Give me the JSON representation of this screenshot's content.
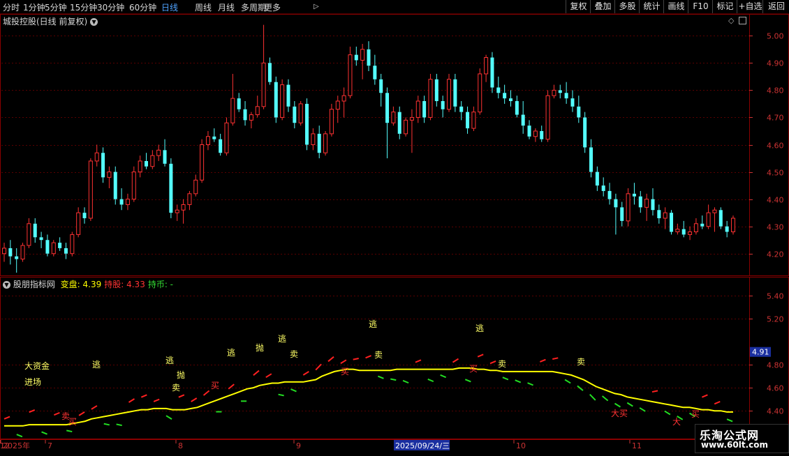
{
  "toolbar": {
    "periods": [
      "分时",
      "1分钟",
      "5分钟",
      "15分钟",
      "30分钟",
      "60分钟",
      "日线",
      "周线",
      "月线",
      "多周期",
      "更多"
    ],
    "active_period": "日线",
    "more_arrow": "▷",
    "right_buttons": [
      "复权",
      "叠加",
      "多股",
      "统计",
      "画线",
      "F10",
      "标记",
      "+自选",
      "返回"
    ]
  },
  "main_panel": {
    "title": "城投控股(日线 前复权)",
    "title_icon": "chevron-down-circle-icon",
    "top_right_icons": [
      "diamond-icon",
      "expand-icon"
    ],
    "y_ticks": [
      "5.00",
      "4.90",
      "4.80",
      "4.70",
      "4.60",
      "4.50",
      "4.40",
      "4.30",
      "4.20"
    ]
  },
  "indicator_panel": {
    "name": "股朋指标网",
    "labels": [
      {
        "text": "变盘: 4.39",
        "color": "#ffff00"
      },
      {
        "text": "持股: 4.33",
        "color": "#ff3333"
      },
      {
        "text": "持币: -",
        "color": "#33dd33"
      }
    ],
    "y_ticks": [
      "5.40",
      "5.20",
      "4.80",
      "4.60",
      "4.40"
    ],
    "current_value": "4.91",
    "annotations": [
      {
        "text": "大资金",
        "color": "#ffff66"
      },
      {
        "text": "进场",
        "color": "#ffff66"
      },
      {
        "text": "逃",
        "color": "#ffff66"
      },
      {
        "text": "逃",
        "color": "#ffff66"
      },
      {
        "text": "抛",
        "color": "#ffff66"
      },
      {
        "text": "卖",
        "color": "#ffff66"
      },
      {
        "text": "逃",
        "color": "#ffff66"
      },
      {
        "text": "抛",
        "color": "#ffff66"
      },
      {
        "text": "逃",
        "color": "#ffff66"
      },
      {
        "text": "卖",
        "color": "#ffff66"
      },
      {
        "text": "逃",
        "color": "#ffff66"
      },
      {
        "text": "卖",
        "color": "#ffff66"
      },
      {
        "text": "逃",
        "color": "#ffff66"
      },
      {
        "text": "卖",
        "color": "#ffff66"
      },
      {
        "text": "卖",
        "color": "#ffff66"
      },
      {
        "text": "卖",
        "color": "#ff3333"
      },
      {
        "text": "买",
        "color": "#ff3333"
      },
      {
        "text": "买",
        "color": "#ff3333"
      },
      {
        "text": "买",
        "color": "#ff3333"
      },
      {
        "text": "买",
        "color": "#ff3333"
      },
      {
        "text": "大买",
        "color": "#ff3333"
      },
      {
        "text": "大",
        "color": "#ff3333"
      },
      {
        "text": "买",
        "color": "#ff3333"
      }
    ]
  },
  "x_axis": {
    "labels": [
      "2025年",
      "7",
      "8",
      "9",
      "2025/09/24/三",
      "10",
      "11",
      "12"
    ]
  },
  "watermark": {
    "title": "乐淘公式网",
    "url": "www.60lt.com"
  },
  "colors": {
    "up": "#ff3232",
    "down": "#54ffff",
    "ma_line": "#ffff00",
    "grid": "#5a0000",
    "axis_text": "#cc3333",
    "border": "#8a0000"
  },
  "chart_data": {
    "type": "candlestick",
    "title": "城投控股(日线 前复权)",
    "ylim": [
      4.12,
      5.08
    ],
    "candles": [
      [
        4.2,
        4.24,
        4.17,
        4.22
      ],
      [
        4.22,
        4.25,
        4.16,
        4.19
      ],
      [
        4.19,
        4.22,
        4.13,
        4.18
      ],
      [
        4.18,
        4.24,
        4.17,
        4.23
      ],
      [
        4.23,
        4.33,
        4.22,
        4.31
      ],
      [
        4.31,
        4.33,
        4.24,
        4.26
      ],
      [
        4.26,
        4.28,
        4.22,
        4.25
      ],
      [
        4.25,
        4.27,
        4.19,
        4.2
      ],
      [
        4.2,
        4.25,
        4.19,
        4.24
      ],
      [
        4.24,
        4.26,
        4.21,
        4.22
      ],
      [
        4.22,
        4.24,
        4.18,
        4.2
      ],
      [
        4.2,
        4.28,
        4.19,
        4.27
      ],
      [
        4.27,
        4.37,
        4.26,
        4.35
      ],
      [
        4.35,
        4.37,
        4.31,
        4.33
      ],
      [
        4.33,
        4.55,
        4.32,
        4.54
      ],
      [
        4.54,
        4.6,
        4.52,
        4.57
      ],
      [
        4.57,
        4.59,
        4.46,
        4.48
      ],
      [
        4.48,
        4.52,
        4.44,
        4.5
      ],
      [
        4.5,
        4.52,
        4.38,
        4.4
      ],
      [
        4.4,
        4.44,
        4.36,
        4.38
      ],
      [
        4.38,
        4.42,
        4.36,
        4.4
      ],
      [
        4.4,
        4.52,
        4.39,
        4.5
      ],
      [
        4.5,
        4.56,
        4.48,
        4.54
      ],
      [
        4.54,
        4.57,
        4.51,
        4.52
      ],
      [
        4.52,
        4.58,
        4.51,
        4.56
      ],
      [
        4.56,
        4.6,
        4.54,
        4.58
      ],
      [
        4.58,
        4.62,
        4.52,
        4.53
      ],
      [
        4.53,
        4.55,
        4.33,
        4.35
      ],
      [
        4.35,
        4.38,
        4.32,
        4.36
      ],
      [
        4.36,
        4.4,
        4.31,
        4.38
      ],
      [
        4.38,
        4.43,
        4.36,
        4.42
      ],
      [
        4.42,
        4.49,
        4.41,
        4.47
      ],
      [
        4.47,
        4.62,
        4.46,
        4.6
      ],
      [
        4.6,
        4.65,
        4.58,
        4.63
      ],
      [
        4.63,
        4.66,
        4.61,
        4.62
      ],
      [
        4.62,
        4.64,
        4.56,
        4.57
      ],
      [
        4.57,
        4.7,
        4.56,
        4.68
      ],
      [
        4.68,
        4.86,
        4.67,
        4.77
      ],
      [
        4.77,
        4.79,
        4.72,
        4.73
      ],
      [
        4.73,
        4.76,
        4.67,
        4.69
      ],
      [
        4.69,
        4.72,
        4.66,
        4.71
      ],
      [
        4.71,
        4.78,
        4.7,
        4.74
      ],
      [
        4.74,
        5.04,
        4.73,
        4.9
      ],
      [
        4.9,
        4.92,
        4.82,
        4.83
      ],
      [
        4.83,
        4.85,
        4.68,
        4.7
      ],
      [
        4.7,
        4.84,
        4.69,
        4.82
      ],
      [
        4.82,
        4.84,
        4.72,
        4.74
      ],
      [
        4.74,
        4.76,
        4.66,
        4.68
      ],
      [
        4.68,
        4.76,
        4.67,
        4.75
      ],
      [
        4.75,
        4.77,
        4.58,
        4.6
      ],
      [
        4.6,
        4.66,
        4.58,
        4.64
      ],
      [
        4.64,
        4.67,
        4.55,
        4.57
      ],
      [
        4.57,
        4.65,
        4.56,
        4.64
      ],
      [
        4.64,
        4.75,
        4.63,
        4.73
      ],
      [
        4.73,
        4.78,
        4.68,
        4.76
      ],
      [
        4.76,
        4.81,
        4.7,
        4.78
      ],
      [
        4.78,
        4.96,
        4.77,
        4.93
      ],
      [
        4.93,
        4.96,
        4.89,
        4.91
      ],
      [
        4.91,
        4.97,
        4.84,
        4.95
      ],
      [
        4.95,
        4.98,
        4.87,
        4.89
      ],
      [
        4.89,
        4.93,
        4.82,
        4.84
      ],
      [
        4.84,
        4.86,
        4.74,
        4.79
      ],
      [
        4.79,
        4.81,
        4.55,
        4.68
      ],
      [
        4.68,
        4.74,
        4.67,
        4.72
      ],
      [
        4.72,
        4.74,
        4.62,
        4.64
      ],
      [
        4.64,
        4.7,
        4.63,
        4.69
      ],
      [
        4.69,
        4.73,
        4.57,
        4.7
      ],
      [
        4.7,
        4.78,
        4.68,
        4.76
      ],
      [
        4.76,
        4.78,
        4.68,
        4.7
      ],
      [
        4.7,
        4.86,
        4.69,
        4.84
      ],
      [
        4.84,
        4.86,
        4.74,
        4.76
      ],
      [
        4.76,
        4.78,
        4.7,
        4.73
      ],
      [
        4.73,
        4.86,
        4.72,
        4.84
      ],
      [
        4.84,
        4.86,
        4.72,
        4.74
      ],
      [
        4.74,
        4.76,
        4.69,
        4.72
      ],
      [
        4.72,
        4.74,
        4.64,
        4.66
      ],
      [
        4.66,
        4.74,
        4.65,
        4.72
      ],
      [
        4.72,
        4.88,
        4.71,
        4.86
      ],
      [
        4.86,
        4.93,
        4.83,
        4.92
      ],
      [
        4.92,
        4.94,
        4.79,
        4.81
      ],
      [
        4.81,
        4.85,
        4.77,
        4.79
      ],
      [
        4.79,
        4.82,
        4.75,
        4.77
      ],
      [
        4.77,
        4.8,
        4.74,
        4.76
      ],
      [
        4.76,
        4.78,
        4.7,
        4.71
      ],
      [
        4.71,
        4.76,
        4.64,
        4.67
      ],
      [
        4.67,
        4.69,
        4.62,
        4.63
      ],
      [
        4.63,
        4.66,
        4.61,
        4.65
      ],
      [
        4.65,
        4.67,
        4.61,
        4.62
      ],
      [
        4.62,
        4.8,
        4.61,
        4.78
      ],
      [
        4.78,
        4.82,
        4.77,
        4.8
      ],
      [
        4.8,
        4.82,
        4.77,
        4.79
      ],
      [
        4.79,
        4.83,
        4.75,
        4.77
      ],
      [
        4.77,
        4.8,
        4.72,
        4.74
      ],
      [
        4.74,
        4.78,
        4.68,
        4.7
      ],
      [
        4.7,
        4.72,
        4.57,
        4.59
      ],
      [
        4.59,
        4.62,
        4.48,
        4.5
      ],
      [
        4.5,
        4.52,
        4.43,
        4.45
      ],
      [
        4.45,
        4.48,
        4.41,
        4.43
      ],
      [
        4.43,
        4.46,
        4.38,
        4.4
      ],
      [
        4.4,
        4.42,
        4.27,
        4.37
      ],
      [
        4.37,
        4.39,
        4.3,
        4.32
      ],
      [
        4.32,
        4.44,
        4.3,
        4.42
      ],
      [
        4.42,
        4.46,
        4.38,
        4.41
      ],
      [
        4.41,
        4.43,
        4.35,
        4.37
      ],
      [
        4.37,
        4.42,
        4.32,
        4.4
      ],
      [
        4.4,
        4.44,
        4.34,
        4.36
      ],
      [
        4.36,
        4.38,
        4.31,
        4.33
      ],
      [
        4.33,
        4.37,
        4.29,
        4.35
      ],
      [
        4.35,
        4.36,
        4.27,
        4.28
      ],
      [
        4.28,
        4.31,
        4.27,
        4.29
      ],
      [
        4.29,
        4.32,
        4.26,
        4.27
      ],
      [
        4.27,
        4.3,
        4.25,
        4.28
      ],
      [
        4.28,
        4.33,
        4.27,
        4.31
      ],
      [
        4.31,
        4.34,
        4.29,
        4.3
      ],
      [
        4.3,
        4.38,
        4.29,
        4.35
      ],
      [
        4.35,
        4.37,
        4.28,
        4.36
      ],
      [
        4.36,
        4.37,
        4.29,
        4.3
      ],
      [
        4.3,
        4.32,
        4.26,
        4.28
      ],
      [
        4.28,
        4.34,
        4.27,
        4.33
      ]
    ],
    "indicator": {
      "ylim": [
        4.16,
        5.56
      ],
      "line": [
        4.27,
        4.27,
        4.27,
        4.27,
        4.28,
        4.28,
        4.28,
        4.28,
        4.28,
        4.28,
        4.28,
        4.29,
        4.3,
        4.31,
        4.33,
        4.34,
        4.35,
        4.36,
        4.37,
        4.38,
        4.39,
        4.4,
        4.41,
        4.41,
        4.42,
        4.42,
        4.42,
        4.41,
        4.41,
        4.41,
        4.42,
        4.43,
        4.45,
        4.47,
        4.49,
        4.51,
        4.53,
        4.55,
        4.57,
        4.59,
        4.6,
        4.62,
        4.63,
        4.64,
        4.64,
        4.65,
        4.65,
        4.65,
        4.65,
        4.66,
        4.67,
        4.7,
        4.72,
        4.74,
        4.75,
        4.76,
        4.76,
        4.75,
        4.75,
        4.75,
        4.75,
        4.75,
        4.75,
        4.76,
        4.76,
        4.76,
        4.76,
        4.76,
        4.76,
        4.76,
        4.76,
        4.76,
        4.76,
        4.77,
        4.77,
        4.77,
        4.76,
        4.76,
        4.75,
        4.75,
        4.74,
        4.74,
        4.74,
        4.74,
        4.74,
        4.74,
        4.74,
        4.74,
        4.74,
        4.73,
        4.72,
        4.71,
        4.69,
        4.67,
        4.64,
        4.61,
        4.59,
        4.57,
        4.55,
        4.54,
        4.52,
        4.51,
        4.5,
        4.49,
        4.48,
        4.47,
        4.46,
        4.45,
        4.44,
        4.43,
        4.43,
        4.42,
        4.41,
        4.41,
        4.4,
        4.4,
        4.39,
        4.39
      ]
    }
  }
}
